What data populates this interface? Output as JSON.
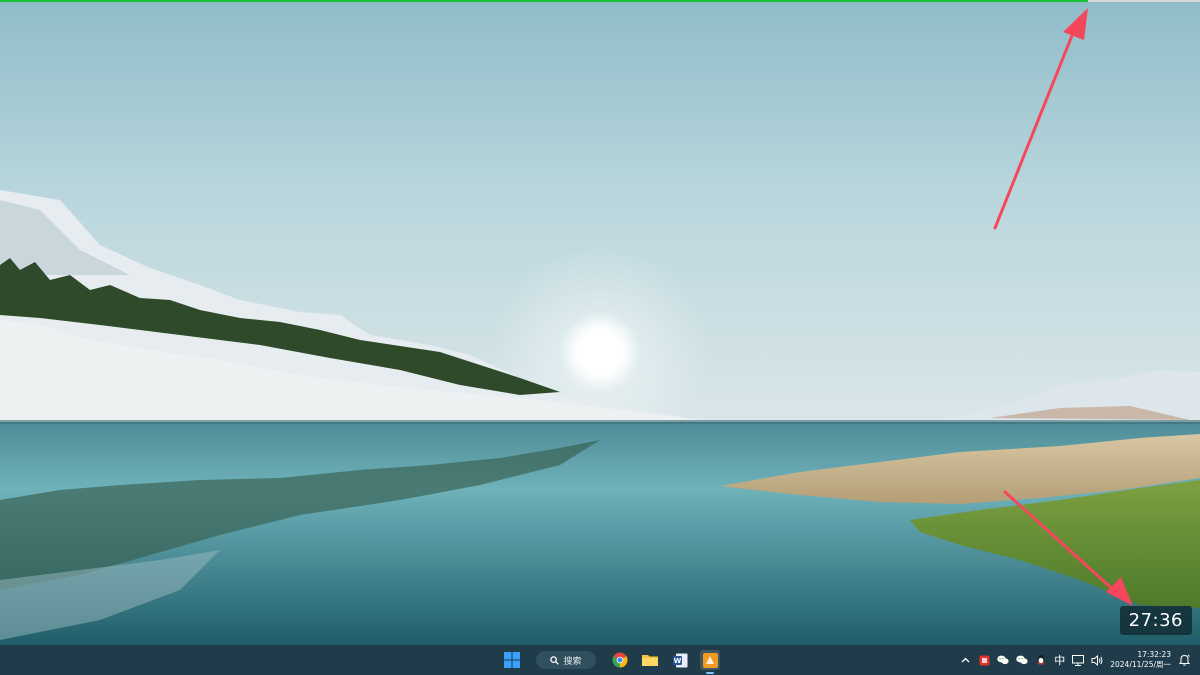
{
  "progress": {
    "fraction": 0.907,
    "color": "#18c437",
    "track_color": "#d7d7d7"
  },
  "overlay": {
    "timer_text": "27:36",
    "arrows": [
      {
        "icon": "red-arrow-up",
        "color": "#f5475c"
      },
      {
        "icon": "red-arrow-down",
        "color": "#f5475c"
      }
    ]
  },
  "taskbar": {
    "search_label": "搜索",
    "apps": [
      {
        "name": "start",
        "icon": "windows-logo-icon"
      },
      {
        "name": "search",
        "icon": "search-icon"
      },
      {
        "name": "chrome",
        "icon": "chrome-icon"
      },
      {
        "name": "file-explorer",
        "icon": "folder-icon"
      },
      {
        "name": "word",
        "icon": "word-icon"
      },
      {
        "name": "app",
        "icon": "orange-app-icon",
        "active": true
      }
    ],
    "tray": {
      "icons": [
        "chevron-up-icon",
        "red-app-icon",
        "wechat-icon",
        "wechat-icon",
        "qq-icon"
      ],
      "ime_label": "中",
      "time": "17:32:23",
      "date": "2024/11/25/周一"
    }
  }
}
